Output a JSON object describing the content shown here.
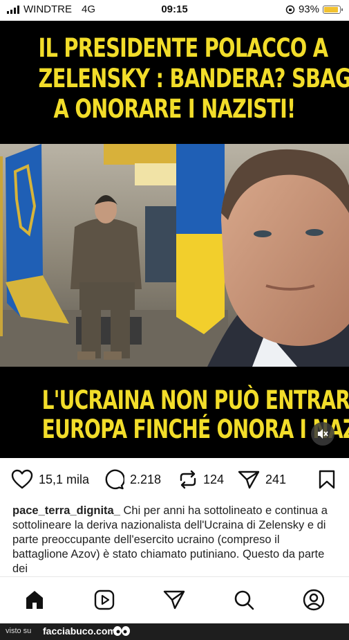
{
  "status_bar": {
    "carrier": "WINDTRE",
    "network": "4G",
    "time": "09:15",
    "battery_percent": "93%",
    "battery_level": 0.93
  },
  "post": {
    "headline_lines": [
      "IL PRESIDENTE POLACCO A",
      "ZELENSKY : BANDERA? SBAGLI",
      "A ONORARE I NAZISTI!"
    ],
    "caption_lines": [
      "L'UCRAINA NON PUÒ ENTRARE IN",
      "EUROPA FINCHÉ ONORA I NAZISTI"
    ],
    "accent_color": "#f2dd2a"
  },
  "actions": {
    "likes": "15,1 mila",
    "comments": "2.218",
    "reposts": "124",
    "shares": "241"
  },
  "description": {
    "username": "pace_terra_dignita_",
    "text": "Chi per anni ha sottolineato e continua a sottolineare la deriva nazionalista dell'Ucraina di Zelensky e di parte preoccupante dell'esercito ucraino (compreso il battaglione Azov) è stato chiamato putiniano. Questo da parte dei"
  },
  "nav": [
    "home-icon",
    "reels-icon",
    "direct-icon",
    "search-icon",
    "profile-icon"
  ],
  "watermark": {
    "prefix": "visto su",
    "site": "facciabuco.com"
  }
}
